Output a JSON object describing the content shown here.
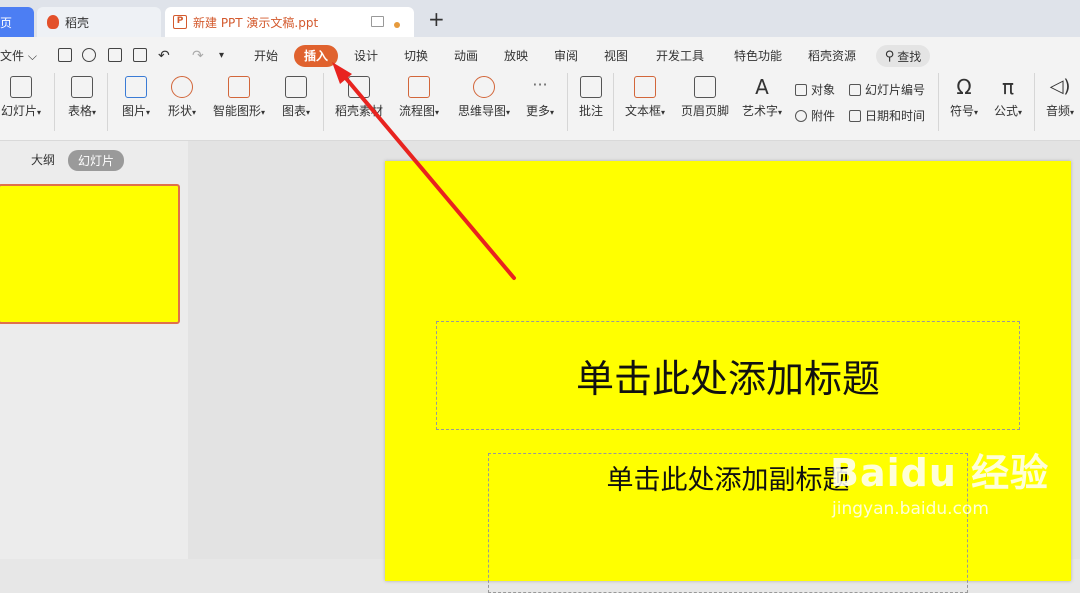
{
  "tabs": {
    "home": "页",
    "daoke": "稻壳",
    "document": "新建 PPT 演示文稿.ppt",
    "new_tab": "+"
  },
  "menu": {
    "file": "文件",
    "items": [
      "开始",
      "插入",
      "设计",
      "切换",
      "动画",
      "放映",
      "审阅",
      "视图",
      "开发工具",
      "特色功能",
      "稻壳资源"
    ],
    "active": "插入",
    "search": "查找"
  },
  "toolbar": {
    "slide": "幻灯片",
    "table": "表格",
    "picture": "图片",
    "shape": "形状",
    "smartart": "智能图形",
    "chart": "图表",
    "material": "稻壳素材",
    "flowchart": "流程图",
    "mindmap": "思维导图",
    "more": "更多",
    "comment": "批注",
    "textbox": "文本框",
    "header_footer": "页眉页脚",
    "wordart": "艺术字",
    "object": "对象",
    "attachment": "附件",
    "slide_number": "幻灯片编号",
    "datetime": "日期和时间",
    "symbol": "符号",
    "formula": "公式",
    "audio": "音频"
  },
  "leftpane": {
    "outline": "大纲",
    "slides": "幻灯片"
  },
  "slide": {
    "title_placeholder": "单击此处添加标题",
    "subtitle_placeholder": "单击此处添加副标题"
  },
  "watermark": {
    "logo": "Baidu 经验",
    "url": "jingyan.baidu.com"
  },
  "colors": {
    "accent": "#e0622e",
    "slide_bg": "#ffff00",
    "arrow": "#e8231f"
  }
}
